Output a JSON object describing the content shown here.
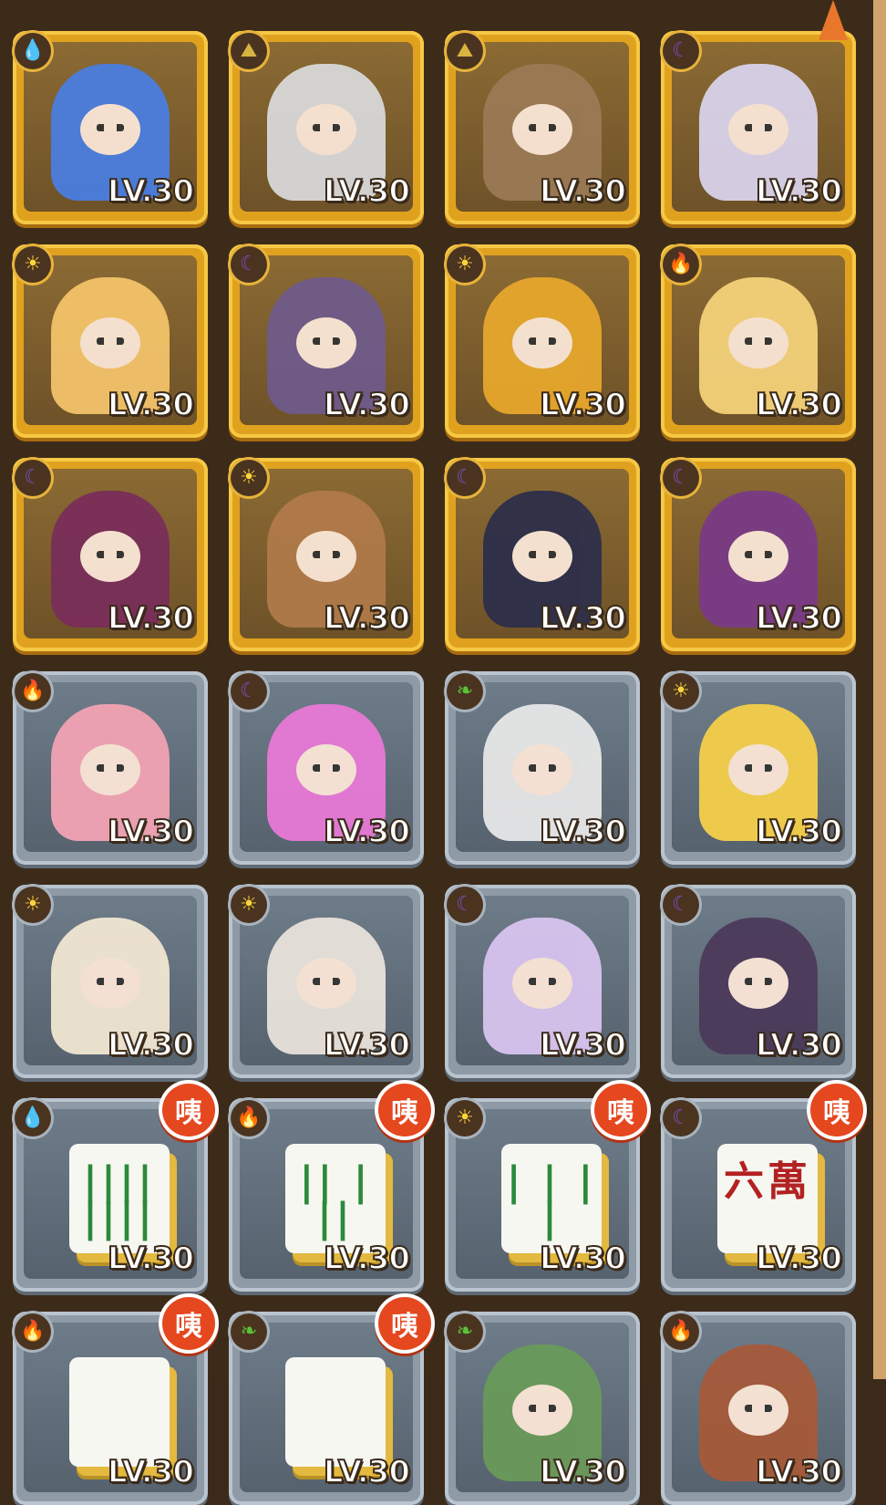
{
  "level_label": "LV.30",
  "badge_text": "咦",
  "cards": [
    {
      "frame": "gold",
      "element": "water",
      "icon": "💧",
      "kind": "hero",
      "color": "#4a7ee0"
    },
    {
      "frame": "gold",
      "element": "earth",
      "icon": "⛰",
      "kind": "hero",
      "color": "#d8d8d8"
    },
    {
      "frame": "gold",
      "element": "earth",
      "icon": "⛰",
      "kind": "hero",
      "color": "#9a7a55"
    },
    {
      "frame": "gold",
      "element": "moon",
      "icon": "☾",
      "kind": "hero",
      "color": "#d9d2ea"
    },
    {
      "frame": "gold",
      "element": "sun",
      "icon": "☀",
      "kind": "hero",
      "color": "#f3c36a"
    },
    {
      "frame": "gold",
      "element": "moon",
      "icon": "☾",
      "kind": "hero",
      "color": "#6f5b8a"
    },
    {
      "frame": "gold",
      "element": "sun",
      "icon": "☀",
      "kind": "hero",
      "color": "#e6a72c"
    },
    {
      "frame": "gold",
      "element": "fire",
      "icon": "🔥",
      "kind": "hero",
      "color": "#f4d27a"
    },
    {
      "frame": "gold",
      "element": "moon",
      "icon": "☾",
      "kind": "hero",
      "color": "#7a2e5a"
    },
    {
      "frame": "gold",
      "element": "sun",
      "icon": "☀",
      "kind": "hero",
      "color": "#b07a4a"
    },
    {
      "frame": "gold",
      "element": "moon",
      "icon": "☾",
      "kind": "hero",
      "color": "#2d2f4a"
    },
    {
      "frame": "gold",
      "element": "moon",
      "icon": "☾",
      "kind": "hero",
      "color": "#7a3a86"
    },
    {
      "frame": "silver",
      "element": "fire",
      "icon": "🔥",
      "kind": "hero",
      "color": "#f2a3b3"
    },
    {
      "frame": "silver",
      "element": "moon",
      "icon": "☾",
      "kind": "hero",
      "color": "#e879d6"
    },
    {
      "frame": "silver",
      "element": "wood",
      "icon": "❧",
      "kind": "hero",
      "color": "#e7e7e7"
    },
    {
      "frame": "silver",
      "element": "sun",
      "icon": "☀",
      "kind": "hero",
      "color": "#f5cf4a"
    },
    {
      "frame": "silver",
      "element": "sun",
      "icon": "☀",
      "kind": "hero",
      "color": "#f1e6d2"
    },
    {
      "frame": "silver",
      "element": "sun",
      "icon": "☀",
      "kind": "hero",
      "color": "#e8e2da"
    },
    {
      "frame": "silver",
      "element": "moon",
      "icon": "☾",
      "kind": "hero",
      "color": "#d8c4ef"
    },
    {
      "frame": "silver",
      "element": "moon",
      "icon": "☾",
      "kind": "hero",
      "color": "#4c3a5a"
    },
    {
      "frame": "silver",
      "element": "water",
      "icon": "💧",
      "kind": "tile",
      "marks": "|||| ||||",
      "badge": true
    },
    {
      "frame": "silver",
      "element": "fire",
      "icon": "🔥",
      "kind": "tile",
      "marks": "|| | ||",
      "badge": true
    },
    {
      "frame": "silver",
      "element": "sun",
      "icon": "☀",
      "kind": "tile",
      "marks": "| | | |",
      "badge": true
    },
    {
      "frame": "silver",
      "element": "moon",
      "icon": "☾",
      "kind": "tile",
      "marks": "六萬",
      "badge": true
    },
    {
      "frame": "silver",
      "element": "fire",
      "icon": "🔥",
      "kind": "tile",
      "marks": "",
      "badge": true
    },
    {
      "frame": "silver",
      "element": "wood",
      "icon": "❧",
      "kind": "tile",
      "marks": "",
      "badge": true
    },
    {
      "frame": "silver",
      "element": "wood",
      "icon": "❧",
      "kind": "hero",
      "color": "#6a9a5a"
    },
    {
      "frame": "silver",
      "element": "fire",
      "icon": "🔥",
      "kind": "hero",
      "color": "#a65a3a"
    }
  ]
}
